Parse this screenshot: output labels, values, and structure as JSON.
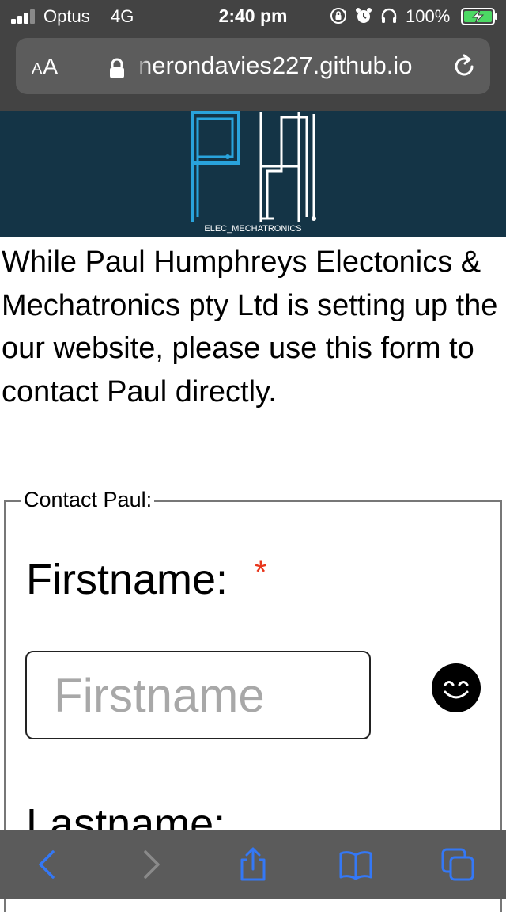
{
  "status_bar": {
    "carrier": "Optus",
    "network": "4G",
    "time": "2:40 pm",
    "battery_percent": "100%",
    "signal_bars_filled": 3,
    "signal_bars_total": 4,
    "icons": [
      "signal-icon",
      "orientation-lock-icon",
      "alarm-icon",
      "headphones-icon",
      "battery-charging-icon"
    ]
  },
  "browser": {
    "reader_label_small": "A",
    "reader_label_large": "A",
    "url": "nerondavies227.github.io",
    "icons": [
      "lock-icon",
      "reload-icon"
    ]
  },
  "header": {
    "logo_caption": "ELEC_MECHATRONICS",
    "background_color": "#143446",
    "logo_color_p": "#29a3dc",
    "logo_color_h": "#ffffff"
  },
  "intro_text": "While Paul Humphreys Electonics & Mechatronics pty Ltd is setting up the our website, please use this form to contact Paul directly.",
  "contact_form": {
    "legend": "Contact Paul:",
    "firstname_label": "Firstname:",
    "required_marker": "*",
    "firstname_placeholder": "Firstname",
    "firstname_value": "",
    "lastname_label": "Lastname:",
    "required_color": "#e8361c"
  },
  "toolbar": {
    "icons": [
      "back-icon",
      "forward-icon",
      "share-icon",
      "bookmarks-icon",
      "tabs-icon"
    ],
    "accent_color": "#3478f6"
  }
}
